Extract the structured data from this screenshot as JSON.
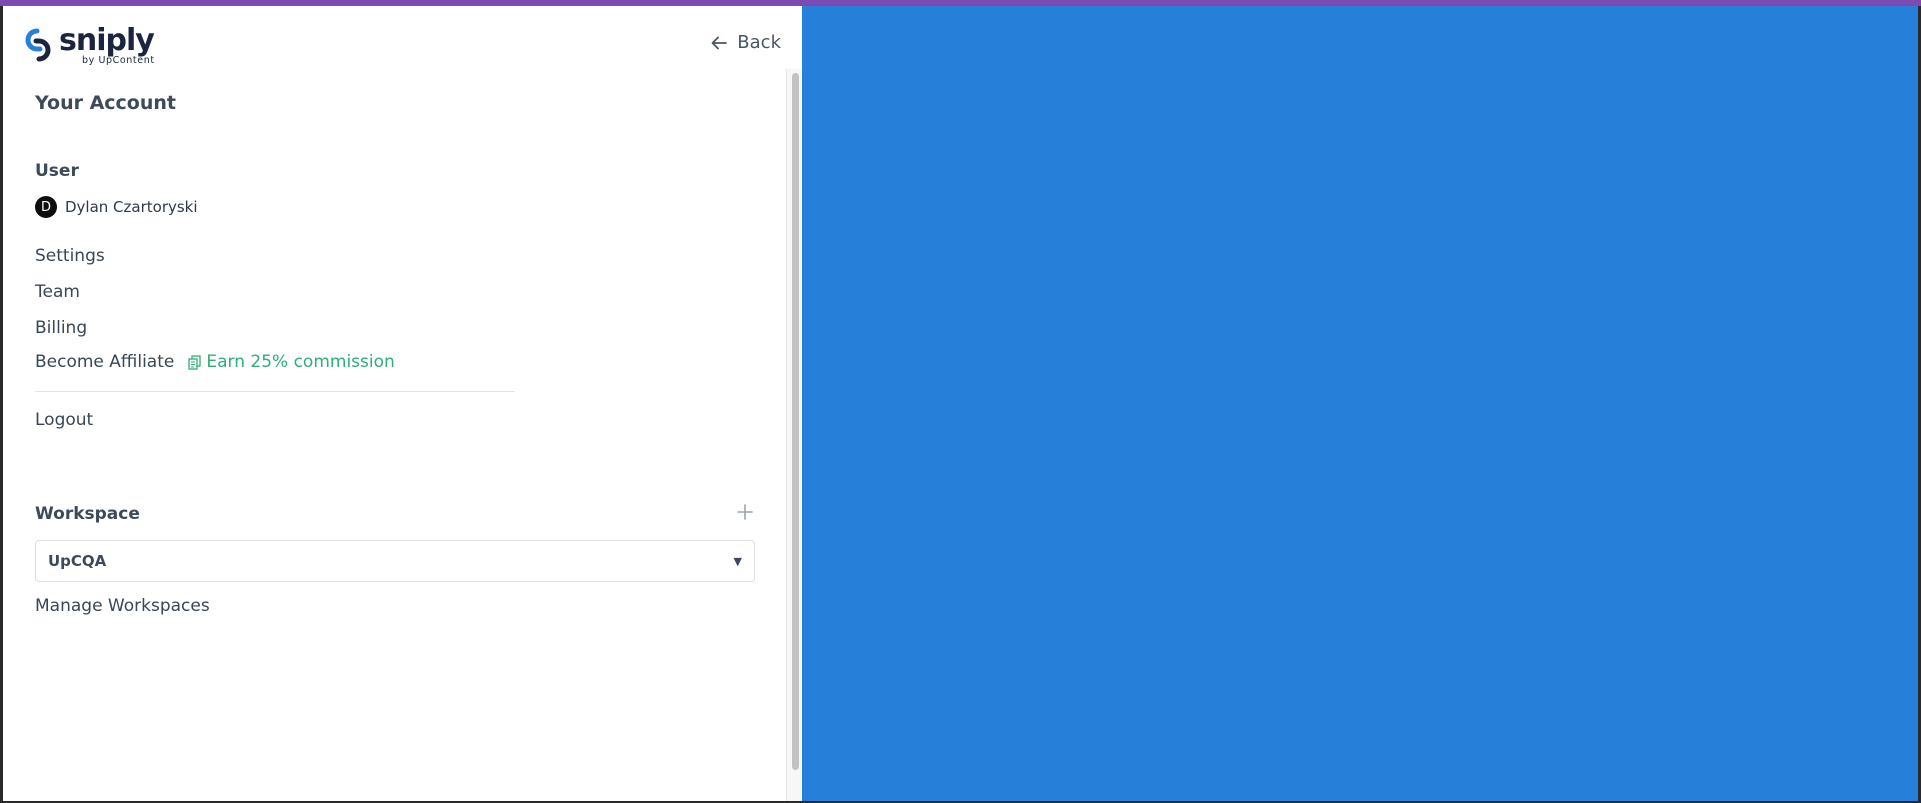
{
  "colors": {
    "accent_top_bar": "#7b4bb3",
    "preview_background": "#2680d9",
    "commission_green": "#2fae76",
    "text": "#3a4656"
  },
  "header": {
    "logo_word": "sniply",
    "logo_sub": "by UpContent",
    "back_label": "Back"
  },
  "account": {
    "title": "Your Account",
    "user_heading": "User",
    "user_initial": "D",
    "user_name": "Dylan Czartoryski",
    "links": {
      "settings": "Settings",
      "team": "Team",
      "billing": "Billing",
      "affiliate": "Become Affiliate",
      "commission": "Earn 25% commission",
      "logout": "Logout"
    }
  },
  "workspace": {
    "heading": "Workspace",
    "selected": "UpCQA",
    "manage_label": "Manage Workspaces"
  },
  "icons": {
    "back": "arrow-left-icon",
    "commission": "copy-icon",
    "add": "plus-icon",
    "caret": "caret-down-icon"
  }
}
